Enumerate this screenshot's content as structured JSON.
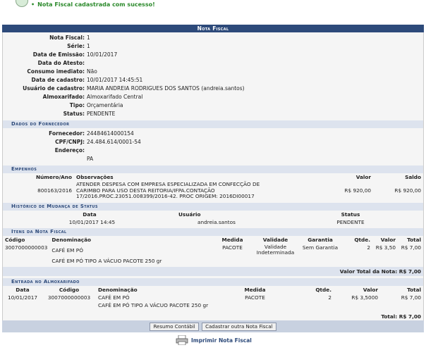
{
  "message": "Nota Fiscal cadastrada com sucesso!",
  "panel_title": "Nota Fiscal",
  "fields": [
    {
      "label": "Nota Fiscal:",
      "value": "1"
    },
    {
      "label": "Série:",
      "value": "1"
    },
    {
      "label": "Data de Emissão:",
      "value": "10/01/2017"
    },
    {
      "label": "Data do Atesto:",
      "value": ""
    },
    {
      "label": "Consumo imediato:",
      "value": "Não"
    },
    {
      "label": "Data de cadastro:",
      "value": "10/01/2017 14:45:51"
    },
    {
      "label": "Usuário de cadastro:",
      "value": "MARIA ANDREIA RODRIGUES DOS SANTOS (andreia.santos)"
    },
    {
      "label": "Almoxarifado:",
      "value": "Almoxarifado Central"
    },
    {
      "label": "Tipo:",
      "value": "Orçamentária"
    },
    {
      "label": "Status:",
      "value": "PENDENTE"
    }
  ],
  "fornecedor": {
    "title": "Dados do Fornecedor",
    "fields": [
      {
        "label": "Fornecedor:",
        "value": "24484614000154"
      },
      {
        "label": "CPF/CNPJ:",
        "value": "24.484.614/0001-54"
      },
      {
        "label": "Endereço:",
        "value": ""
      },
      {
        "label": "",
        "value": "PA"
      }
    ]
  },
  "empenhos": {
    "title": "Empenhos",
    "headers": [
      "Número/Ano",
      "Observações",
      "Valor",
      "Saldo"
    ],
    "rows": [
      {
        "numero": "800163/2016",
        "obs": "ATENDER DESPESA COM EMPRESA ESPECIALIZADA EM CONFECÇÃO DE CARIMBO PARA USO DESTA REITORIA/IFPA.CONTAÇÃO 17/2016.PROC.23051.008399/2016-42. PROC ORIGEM: 2016DI00017",
        "valor": "R$ 920,00",
        "saldo": "R$ 920,00"
      }
    ]
  },
  "historico": {
    "title": "Histórico de Mudança de Status",
    "headers": [
      "Data",
      "Usuário",
      "Status"
    ],
    "rows": [
      {
        "data": "10/01/2017 14:45",
        "usuario": "andreia.santos",
        "status": "PENDENTE"
      }
    ]
  },
  "itens": {
    "title": "Itens da Nota Fiscal",
    "headers": [
      "Código",
      "Denominação",
      "Medida",
      "Validade",
      "Garantia",
      "Qtde.",
      "Valor",
      "Total"
    ],
    "row": {
      "codigo": "3007000000003",
      "denominacao": "CAFÉ EM PÓ",
      "medida": "PACOTE",
      "validade": "Validade Indeterminada",
      "garantia": "Sem Garantia",
      "qtde": "2",
      "valor": "R$ 3,50",
      "total": "R$ 7,00"
    },
    "desc": "CAFÉ EM PÓ TIPO A VÁCUO PACOTE 250 gr",
    "total_label": "Valor Total da Nota:",
    "total_value": "R$ 7,00"
  },
  "entrada": {
    "title": "Entrada no Almoxarifado",
    "headers": [
      "Data",
      "Código",
      "Denominação",
      "Medida",
      "Qtde.",
      "Valor",
      "Total"
    ],
    "row": {
      "data": "10/01/2017",
      "codigo": "3007000000003",
      "denominacao": "CAFÉ EM PÓ",
      "medida": "PACOTE",
      "qtde": "2",
      "valor": "R$ 3,5000",
      "total": "R$ 7,00"
    },
    "desc": "CAFÉ EM PÓ TIPO A VÁCUO PACOTE 250 gr",
    "total": "Total: R$ 7,00"
  },
  "buttons": {
    "resumo": "Resumo Contábil",
    "cadastrar": "Cadastrar outra Nota Fiscal"
  },
  "print_label": "Imprimir Nota Fiscal",
  "icons": {
    "message": "info-icon",
    "print": "printer-icon"
  }
}
